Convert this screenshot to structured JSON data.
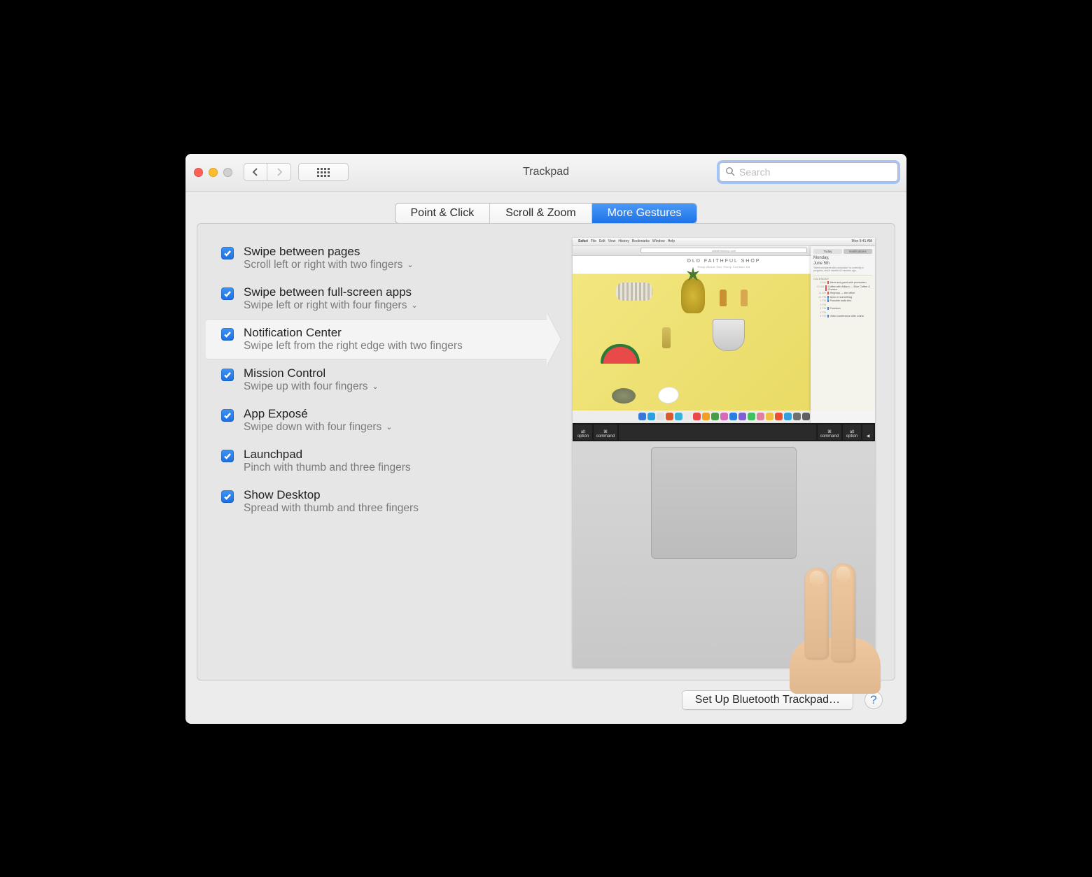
{
  "window": {
    "title": "Trackpad"
  },
  "search": {
    "placeholder": "Search",
    "value": ""
  },
  "tabs": [
    {
      "label": "Point & Click",
      "active": false
    },
    {
      "label": "Scroll & Zoom",
      "active": false
    },
    {
      "label": "More Gestures",
      "active": true
    }
  ],
  "options": [
    {
      "title": "Swipe between pages",
      "desc": "Scroll left or right with two fingers",
      "hasDropdown": true,
      "checked": true,
      "selected": false
    },
    {
      "title": "Swipe between full-screen apps",
      "desc": "Swipe left or right with four fingers",
      "hasDropdown": true,
      "checked": true,
      "selected": false
    },
    {
      "title": "Notification Center",
      "desc": "Swipe left from the right edge with two fingers",
      "hasDropdown": false,
      "checked": true,
      "selected": true
    },
    {
      "title": "Mission Control",
      "desc": "Swipe up with four fingers",
      "hasDropdown": true,
      "checked": true,
      "selected": false
    },
    {
      "title": "App Exposé",
      "desc": "Swipe down with four fingers",
      "hasDropdown": true,
      "checked": true,
      "selected": false
    },
    {
      "title": "Launchpad",
      "desc": "Pinch with thumb and three fingers",
      "hasDropdown": false,
      "checked": true,
      "selected": false
    },
    {
      "title": "Show Desktop",
      "desc": "Spread with thumb and three fingers",
      "hasDropdown": false,
      "checked": true,
      "selected": false
    }
  ],
  "preview": {
    "menubar": {
      "apple": "",
      "app": "Safari",
      "menus": [
        "File",
        "Edit",
        "View",
        "History",
        "Bookmarks",
        "Window",
        "Help"
      ],
      "clock": "Mon 9:41 AM"
    },
    "url": "oldfaithfulshop.com",
    "shop_title": "OLD FAITHFUL SHOP",
    "shop_nav": "Shop    About    Our Story    Contact Us",
    "notification_center": {
      "tabs": [
        "Today",
        "Notifications"
      ],
      "date_line1": "Monday,",
      "date_line2": "June 5th",
      "weather": "\"Meet and greet with production\" is currently in progress, and it started 42 minutes ago.",
      "section": "CALENDAR",
      "events": [
        {
          "time": "9 AM",
          "label": "Meet and greet with production",
          "color": "red"
        },
        {
          "time": "10 AM",
          "label": "Coffee with Allison — Blue Coffee & Cheese",
          "color": "red"
        },
        {
          "time": "11 AM",
          "label": "Regroup — the office",
          "color": "red"
        },
        {
          "time": "12 PM",
          "label": "Sync or something",
          "color": "blue"
        },
        {
          "time": "1 PM",
          "label": "Possible walk-thru",
          "color": "blue"
        },
        {
          "time": "2 PM",
          "label": "",
          "color": ""
        },
        {
          "time": "3 PM",
          "label": "Freedom",
          "color": "blue"
        },
        {
          "time": "4 PM",
          "label": "",
          "color": ""
        },
        {
          "time": "5 PM",
          "label": "Video conference with China",
          "color": "blue"
        }
      ]
    },
    "keys": {
      "alt": "alt",
      "option": "option",
      "command": "command",
      "cmd_sym": "⌘"
    }
  },
  "footer": {
    "bluetooth_button": "Set Up Bluetooth Trackpad…",
    "help": "?"
  }
}
